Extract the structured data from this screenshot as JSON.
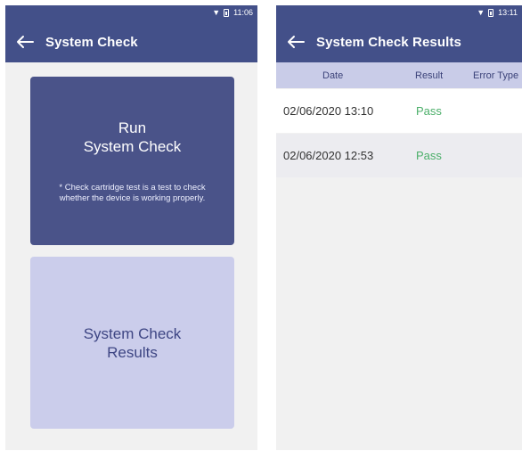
{
  "left_screen": {
    "status_time": "11:06",
    "title": "System Check",
    "run_card": {
      "title_line1": "Run",
      "title_line2": "System Check",
      "note_line1": "* Check cartridge test is a test to check",
      "note_line2": "whether the device is working properly."
    },
    "results_card": {
      "title_line1": "System Check",
      "title_line2": "Results"
    }
  },
  "right_screen": {
    "status_time": "13:11",
    "title": "System Check Results",
    "columns": [
      "Date",
      "Result",
      "Error Type"
    ],
    "rows": [
      {
        "date": "02/06/2020 13:10",
        "result": "Pass"
      },
      {
        "date": "02/06/2020 12:53",
        "result": "Pass"
      }
    ]
  },
  "colors": {
    "primary": "#435089",
    "card_dark": "#4a5389",
    "card_light": "#cbcdeb",
    "pass": "#4caf6a"
  },
  "icons": [
    "wifi-icon",
    "battery-icon",
    "back-arrow-icon"
  ]
}
